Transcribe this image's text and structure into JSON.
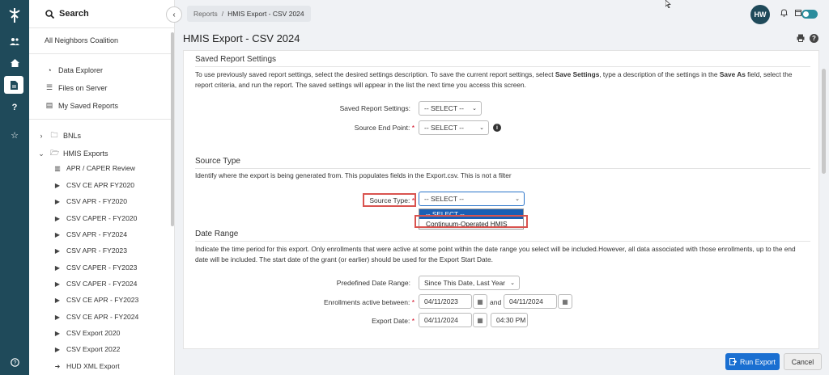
{
  "sidebar": {
    "search_label": "Search",
    "org": "All Neighbors Coalition",
    "top_items": [
      {
        "label": "Data Explorer",
        "icon": "gauge-icon"
      },
      {
        "label": "Files on Server",
        "icon": "list-icon"
      },
      {
        "label": "My Saved Reports",
        "icon": "saved-reports-icon"
      }
    ],
    "folders": [
      {
        "label": "BNLs",
        "expanded": false
      },
      {
        "label": "HMIS Exports",
        "expanded": true
      }
    ],
    "sub_items": [
      "APR / CAPER Review",
      "CSV CE APR FY2020",
      "CSV APR - FY2020",
      "CSV CAPER - FY2020",
      "CSV APR - FY2024",
      "CSV APR - FY2023",
      "CSV CAPER - FY2023",
      "CSV CAPER - FY2024",
      "CSV CE APR - FY2023",
      "CSV CE APR - FY2024",
      "CSV Export 2020",
      "CSV Export 2022",
      "HUD XML Export"
    ]
  },
  "topbar": {
    "breadcrumb_root": "Reports",
    "breadcrumb_sep": "/",
    "breadcrumb_current": "HMIS Export - CSV 2024",
    "avatar_initials": "HW"
  },
  "page": {
    "title": "HMIS Export - CSV 2024"
  },
  "saved_settings": {
    "title": "Saved Report Settings",
    "desc_1": "To use previously saved report settings, select the desired settings description. To save the current report settings, select ",
    "desc_b1": "Save Settings",
    "desc_2": ", type a description of the settings in the ",
    "desc_b2": "Save As",
    "desc_3": " field, select the report criteria, and run the report. The saved settings will appear in the list the next time you access this screen.",
    "saved_label": "Saved Report Settings:",
    "saved_value": "-- SELECT --",
    "endpoint_label": "Source End Point:",
    "endpoint_value": "-- SELECT --",
    "required_mark": "*"
  },
  "source_type": {
    "title": "Source Type",
    "desc": "Identify where the export is being generated from. This populates fields in the Export.csv. This is not a filter",
    "label": "Source Type:",
    "value": "-- SELECT --",
    "options": [
      "-- SELECT --",
      "Continuum-Operated HMIS"
    ]
  },
  "date_range": {
    "title": "Date Range",
    "desc": "Indicate the time period for this export. Only enrollments that were active at some point within the date range you select will be included.However, all data associated with those enrollments, up to the end date will be included. The start date of the grant (or earlier) should be used for the Export Start Date.",
    "predefined_label": "Predefined Date Range:",
    "predefined_value": "Since This Date, Last Year",
    "active_label": "Enrollments active between:",
    "active_start": "04/11/2023",
    "and_label": "and",
    "active_end": "04/11/2024",
    "export_label": "Export Date:",
    "export_date": "04/11/2024",
    "export_time": "04:30 PM"
  },
  "footer": {
    "run_label": "Run Export",
    "cancel_label": "Cancel"
  },
  "colors": {
    "rail": "#1f4a5a",
    "accent": "#1a6fd1",
    "highlight": "#d9534f",
    "required": "#d0021b"
  }
}
